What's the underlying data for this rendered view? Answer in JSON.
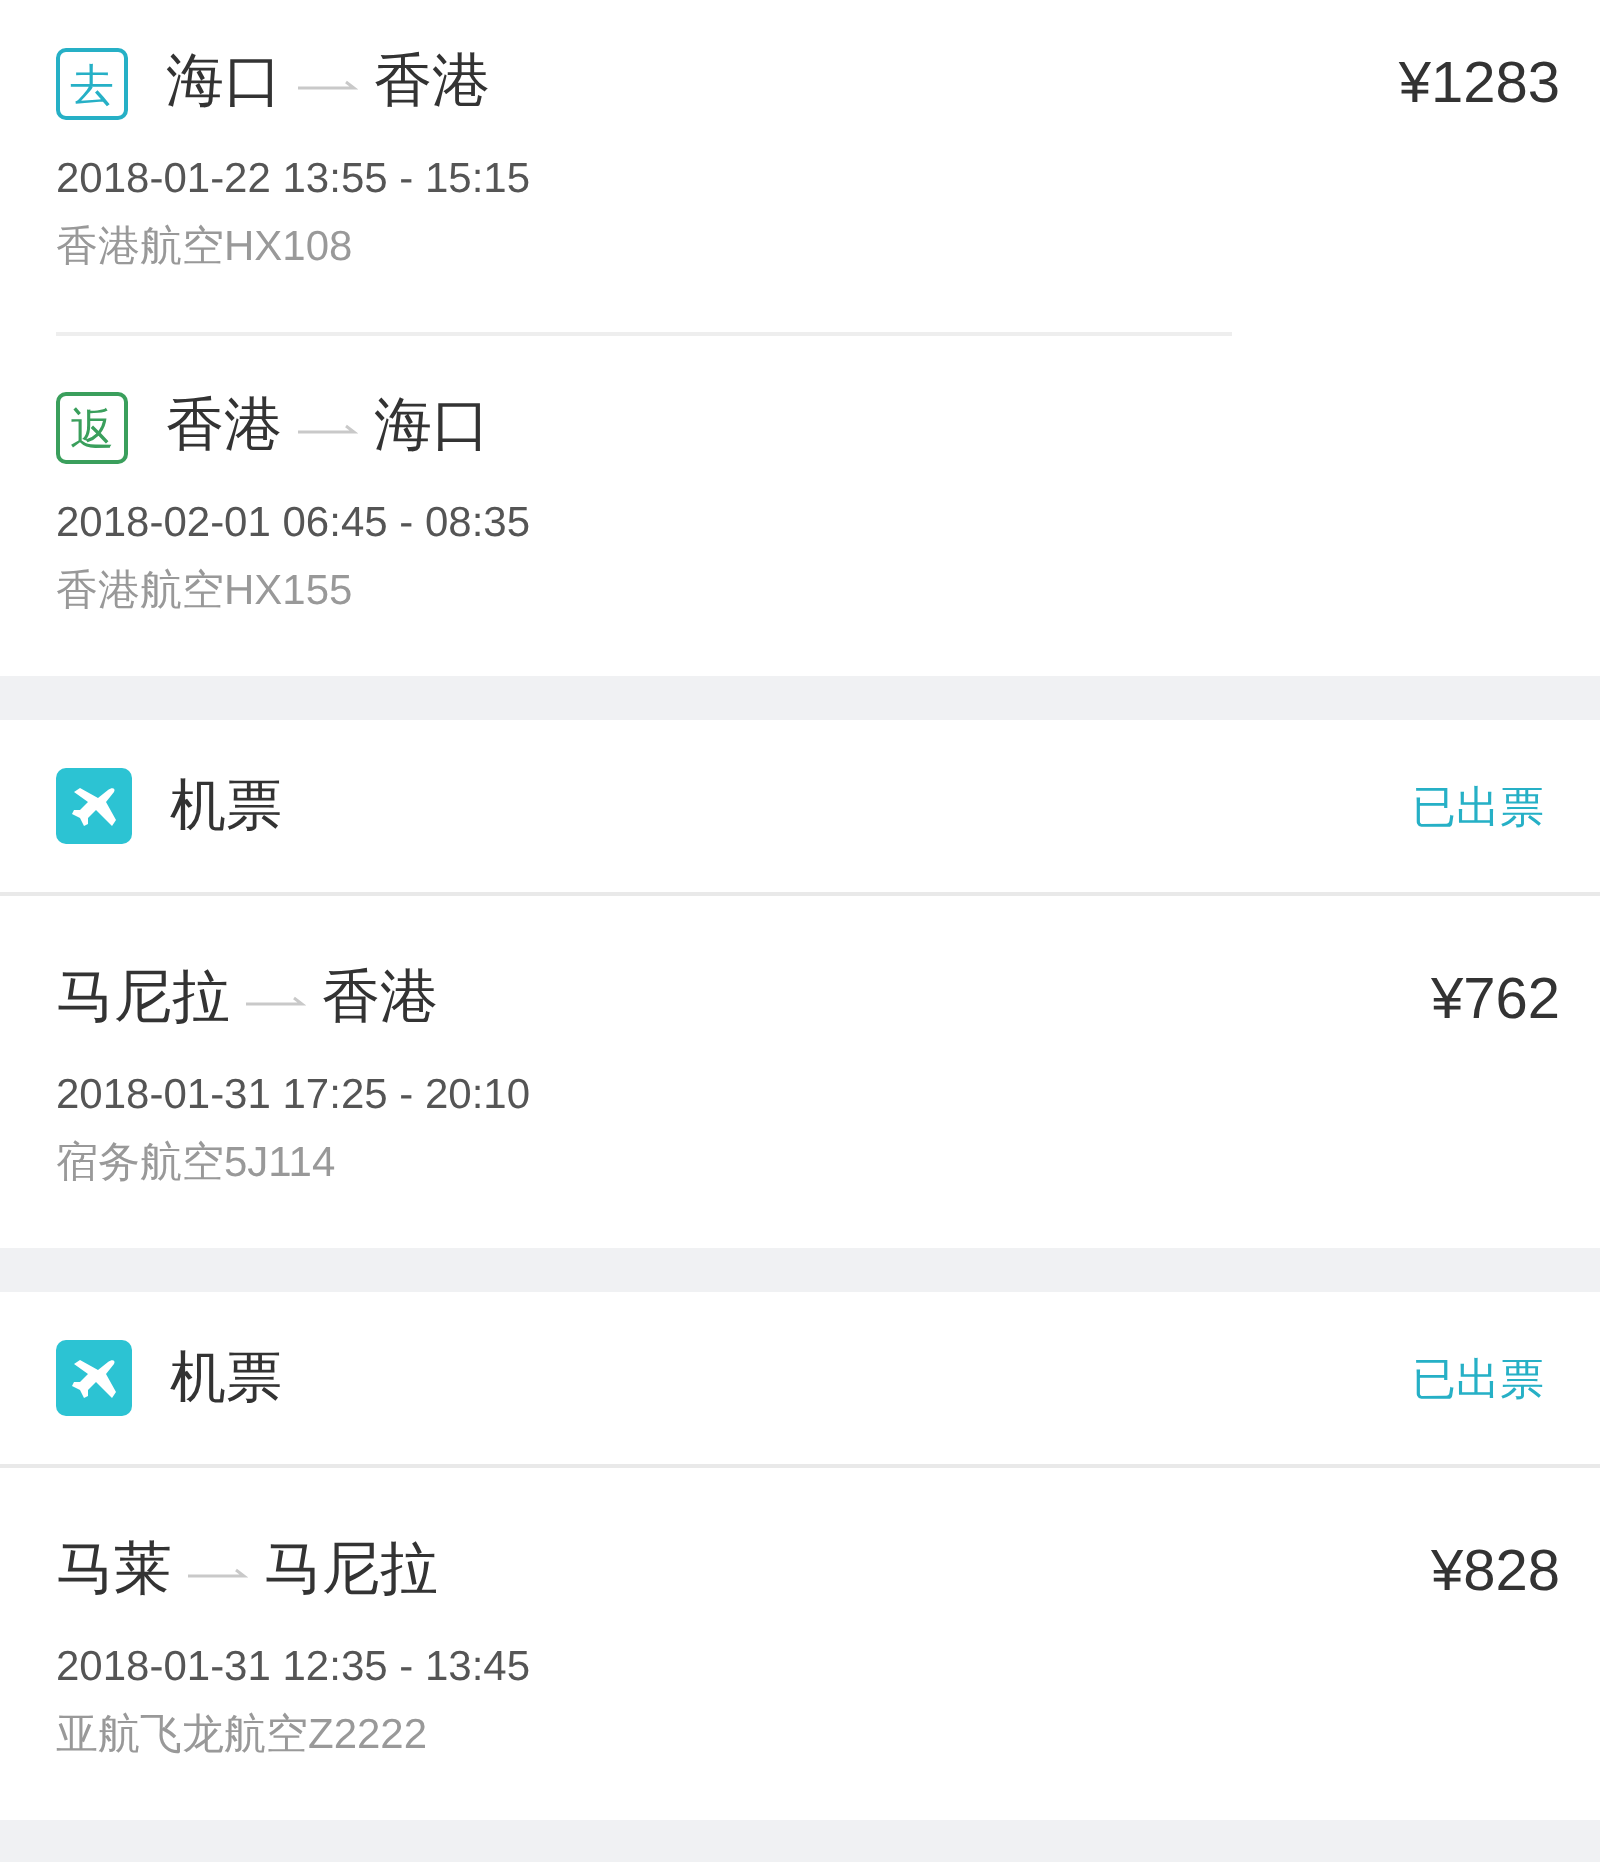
{
  "orders": [
    {
      "price": "¥1283",
      "legs": [
        {
          "tag": "去",
          "color": "#26b0c6",
          "from": "海口",
          "to": "香港",
          "time": "2018-01-22 13:55 - 15:15",
          "flight": "香港航空HX108"
        },
        {
          "tag": "返",
          "color": "#3a9f5c",
          "from": "香港",
          "to": "海口",
          "time": "2018-02-01 06:45 - 08:35",
          "flight": "香港航空HX155"
        }
      ]
    },
    {
      "header": {
        "title": "机票",
        "status": "已出票"
      },
      "price": "¥762",
      "legs": [
        {
          "from": "马尼拉",
          "to": "香港",
          "time": "2018-01-31 17:25 - 20:10",
          "flight": "宿务航空5J114"
        }
      ]
    },
    {
      "header": {
        "title": "机票",
        "status": "已出票"
      },
      "price": "¥828",
      "legs": [
        {
          "from": "马莱",
          "to": "马尼拉",
          "time": "2018-01-31 12:35 - 13:45",
          "flight": "亚航飞龙航空Z2222"
        }
      ]
    }
  ]
}
